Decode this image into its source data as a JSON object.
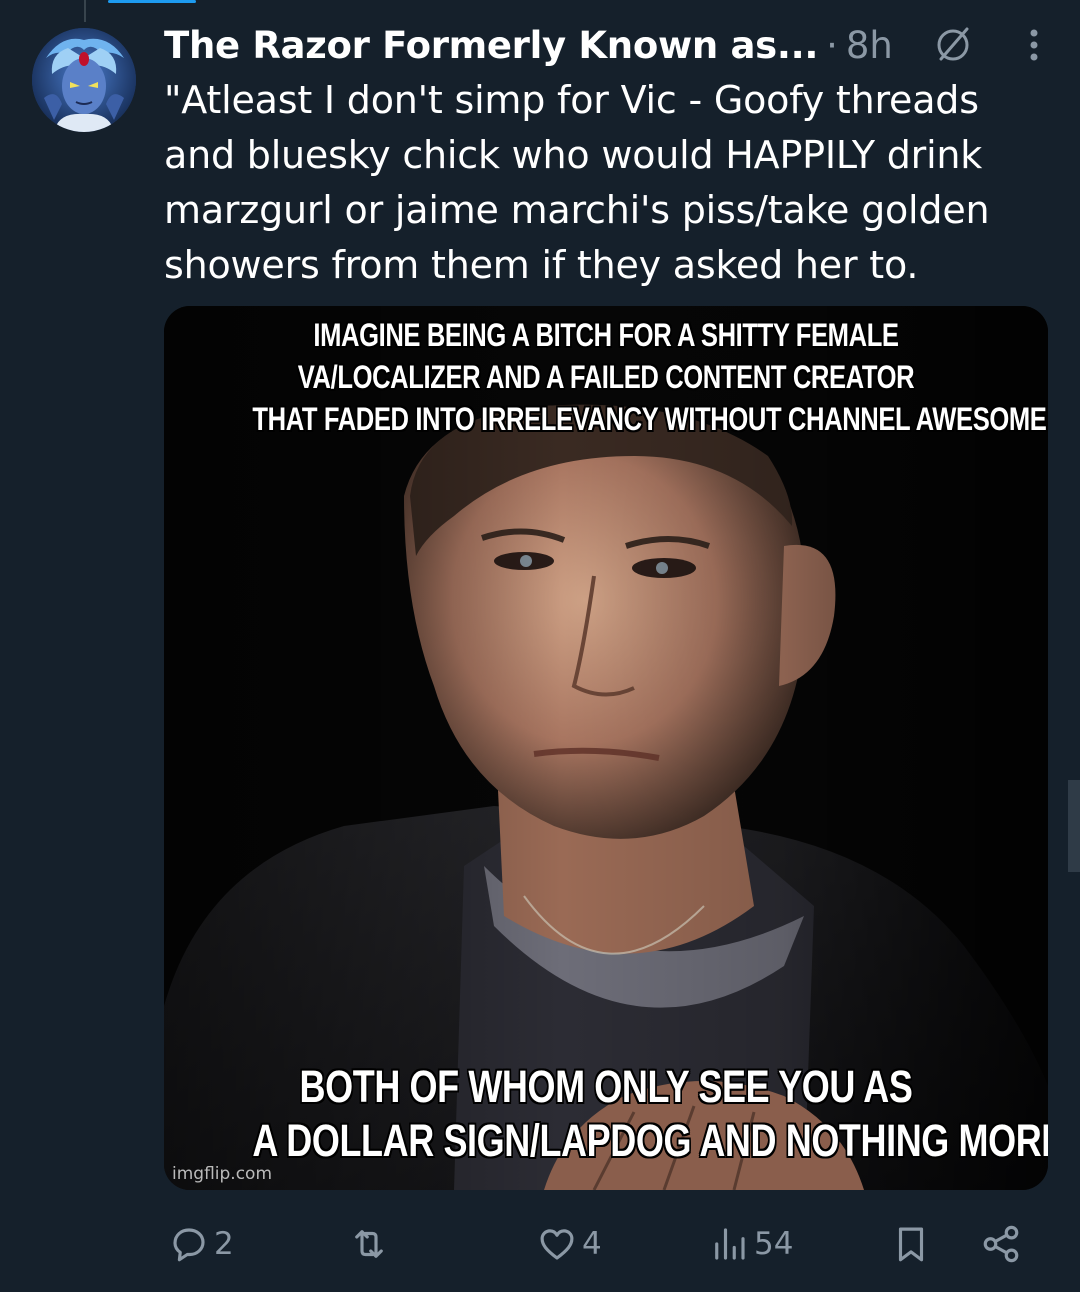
{
  "post": {
    "author_name": "The Razor Formerly Known as...",
    "separator": "·",
    "time": "8h",
    "text": "\"Atleast I don't simp for Vic - Goofy threads\nand bluesky chick who would HAPPILY drink\nmarzgurl or jaime marchi's piss/take golden\nshowers from them if they asked her to."
  },
  "meme": {
    "top_lines": [
      "IMAGINE BEING A BITCH FOR A SHITTY FEMALE",
      "VA/LOCALIZER AND A FAILED CONTENT CREATOR",
      "THAT FADED INTO IRRELEVANCY WITHOUT CHANNEL AWESOME"
    ],
    "bottom_lines": [
      "BOTH OF WHOM ONLY SEE YOU AS",
      "A DOLLAR SIGN/LAPDOG AND NOTHING MORE"
    ],
    "watermark": "imgflip.com"
  },
  "actions": {
    "replies": "2",
    "reposts": "",
    "likes": "4",
    "views": "54"
  },
  "icons": {
    "reply": "reply-icon",
    "repost": "repost-icon",
    "like": "heart-icon",
    "views": "views-icon",
    "bookmark": "bookmark-icon",
    "share": "share-icon",
    "grok": "grok-icon",
    "more": "more-icon"
  },
  "colors": {
    "background": "#15202b",
    "text": "#ffffff",
    "muted": "#8b98a5",
    "accent": "#1d9bf0"
  }
}
